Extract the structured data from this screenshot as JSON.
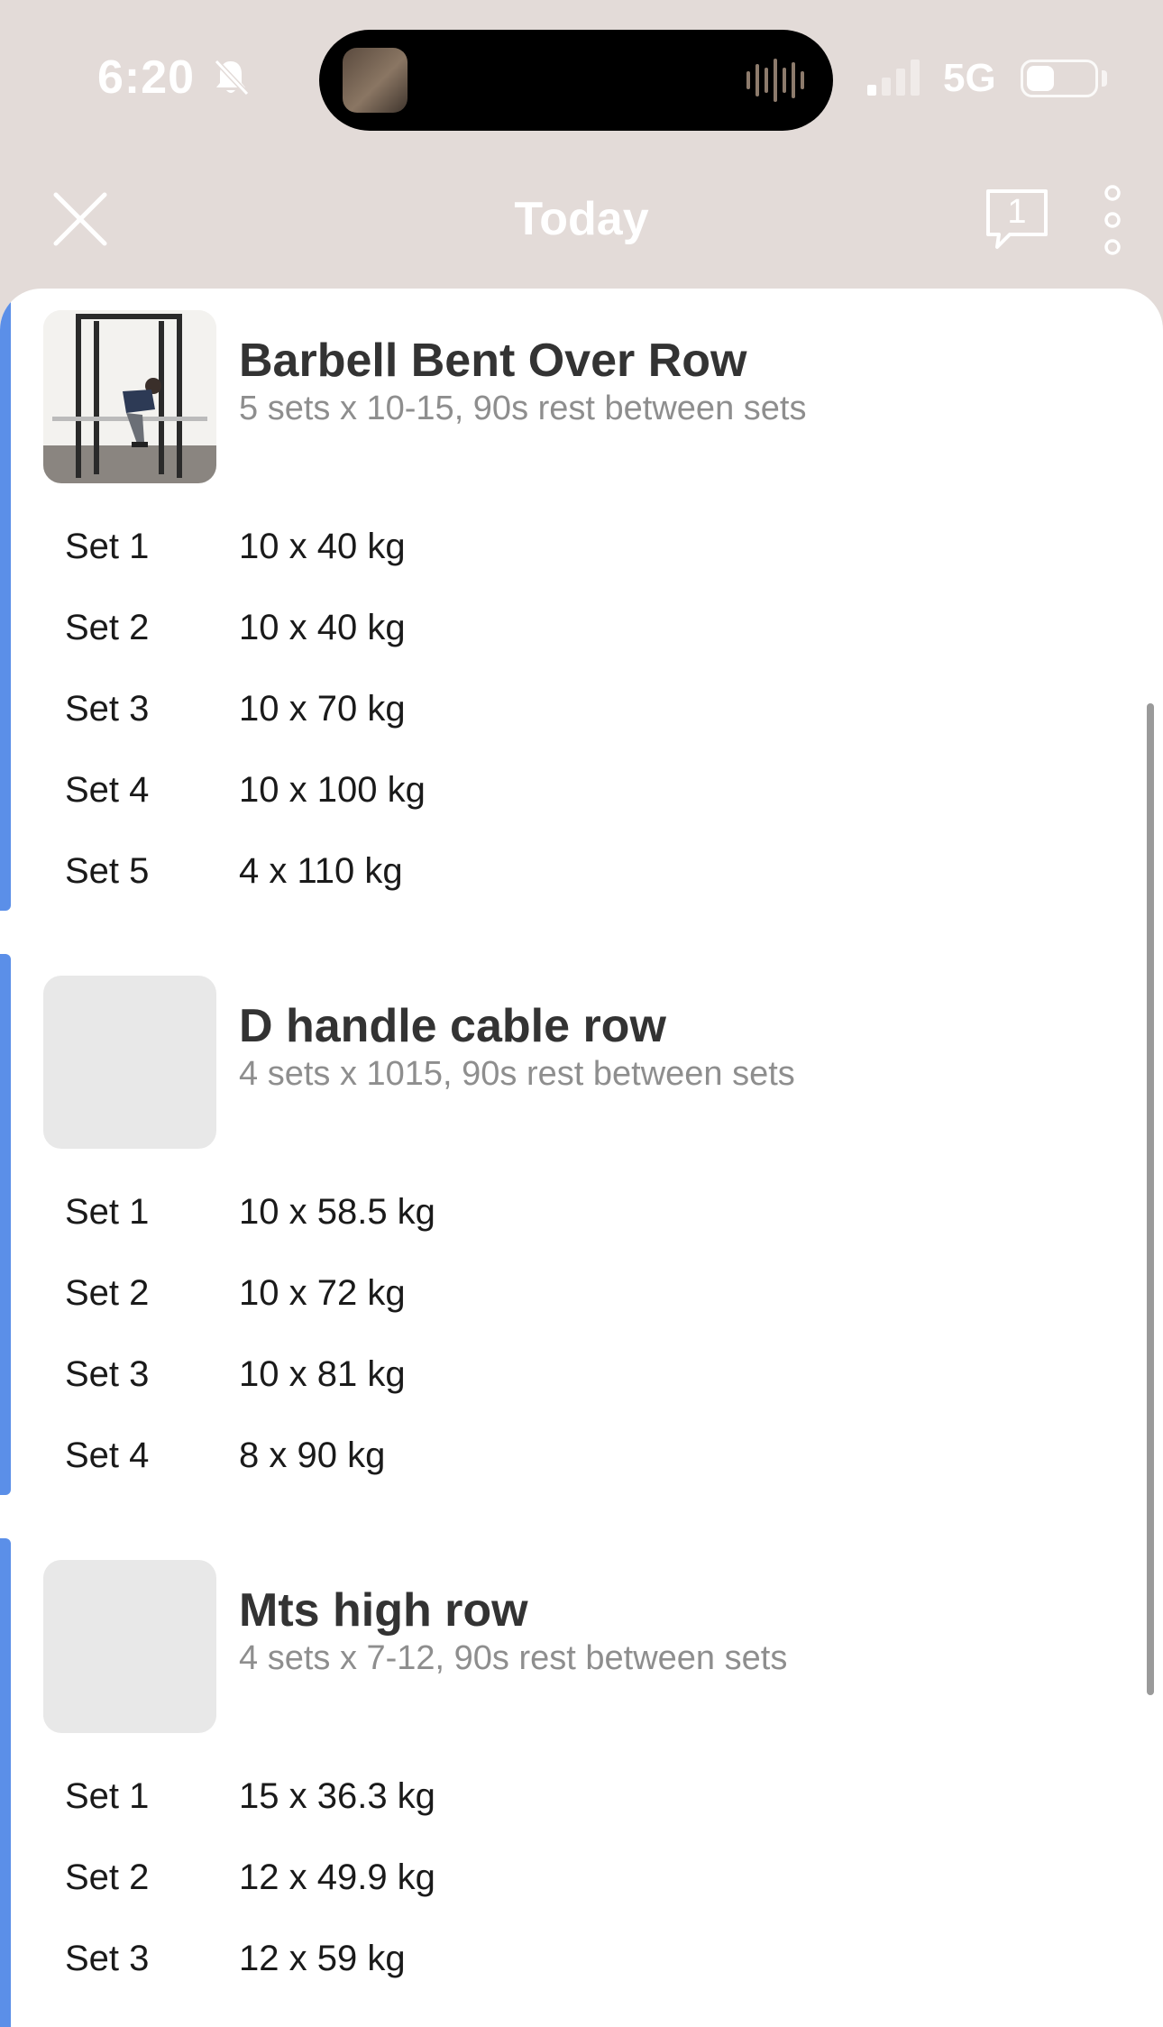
{
  "status_bar": {
    "time": "6:20",
    "network": "5G",
    "icons": [
      "bell-slash-icon",
      "audio-waveform-icon",
      "signal-icon",
      "battery-icon"
    ]
  },
  "nav": {
    "title": "Today",
    "comment_count": "1",
    "icons": [
      "close-icon",
      "comment-icon",
      "more-vertical-icon"
    ]
  },
  "exercises": [
    {
      "title": "Barbell Bent Over Row",
      "subtitle": "5 sets x 10-15, 90s rest between sets",
      "sets": [
        {
          "label": "Set 1",
          "value": "10 x 40 kg"
        },
        {
          "label": "Set 2",
          "value": "10 x 40 kg"
        },
        {
          "label": "Set 3",
          "value": "10 x 70 kg"
        },
        {
          "label": "Set 4",
          "value": "10 x 100 kg"
        },
        {
          "label": "Set 5",
          "value": "4 x 110 kg"
        }
      ]
    },
    {
      "title": "D handle cable row",
      "subtitle": "4 sets x 1015, 90s rest between sets",
      "sets": [
        {
          "label": "Set 1",
          "value": "10 x 58.5 kg"
        },
        {
          "label": "Set 2",
          "value": "10 x 72 kg"
        },
        {
          "label": "Set 3",
          "value": "10 x 81 kg"
        },
        {
          "label": "Set 4",
          "value": "8 x 90 kg"
        }
      ]
    },
    {
      "title": "Mts high row",
      "subtitle": "4 sets x 7-12, 90s rest between sets",
      "sets": [
        {
          "label": "Set 1",
          "value": "15 x 36.3 kg"
        },
        {
          "label": "Set 2",
          "value": "12 x 49.9 kg"
        },
        {
          "label": "Set 3",
          "value": "12 x 59 kg"
        }
      ]
    }
  ],
  "colors": {
    "header_bg": "#e3dbd8",
    "accent": "#5b8fe8",
    "subtitle": "#8e8e8e"
  }
}
